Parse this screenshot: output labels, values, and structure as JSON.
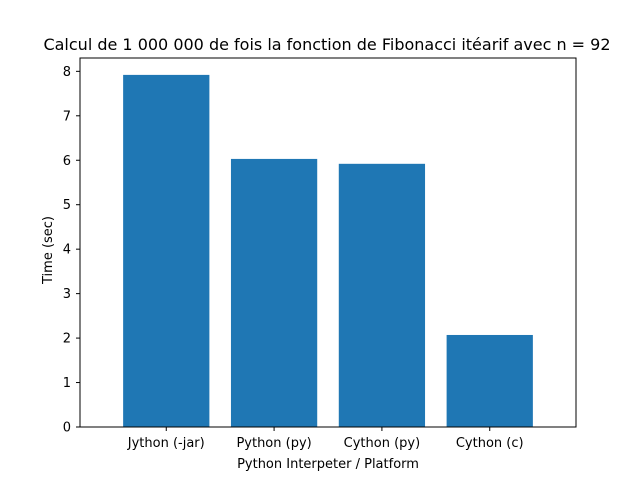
{
  "chart_data": {
    "type": "bar",
    "title": "Calcul de 1 000 000 de fois la fonction de Fibonacci itéarif avec n = 92",
    "xlabel": "Python Interpeter / Platform",
    "ylabel": "Time (sec)",
    "categories": [
      "Jython (-jar)",
      "Python (py)",
      "Cython (py)",
      "Cython (c)"
    ],
    "values": [
      7.92,
      6.03,
      5.92,
      2.07
    ],
    "ylim": [
      0,
      8.3
    ],
    "yticks": [
      "0",
      "1",
      "2",
      "3",
      "4",
      "5",
      "6",
      "7",
      "8"
    ],
    "bar_color": "#1f77b4",
    "grid": false,
    "legend": "none"
  }
}
